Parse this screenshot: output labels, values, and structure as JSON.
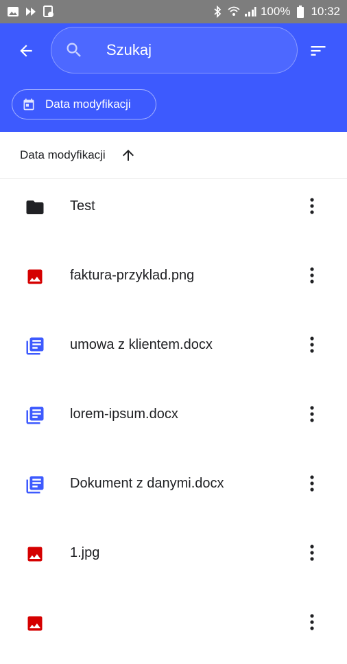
{
  "status_bar": {
    "battery": "100%",
    "time": "10:32"
  },
  "app_bar": {
    "search_placeholder": "Szukaj"
  },
  "filter_chip": {
    "label": "Data modyfikacji"
  },
  "sort": {
    "label": "Data modyfikacji"
  },
  "colors": {
    "accent": "#3d5afe",
    "image_icon": "#d50000",
    "doc_icon": "#3d5afe",
    "folder_icon": "#202124"
  },
  "files": [
    {
      "name": "Test",
      "icon": "folder-icon"
    },
    {
      "name": "faktura-przyklad.png",
      "icon": "image-icon"
    },
    {
      "name": "umowa z klientem.docx",
      "icon": "document-icon"
    },
    {
      "name": "lorem-ipsum.docx",
      "icon": "document-icon"
    },
    {
      "name": "Dokument z danymi.docx",
      "icon": "document-icon"
    },
    {
      "name": "1.jpg",
      "icon": "image-icon"
    },
    {
      "name": "",
      "icon": "image-icon"
    }
  ]
}
